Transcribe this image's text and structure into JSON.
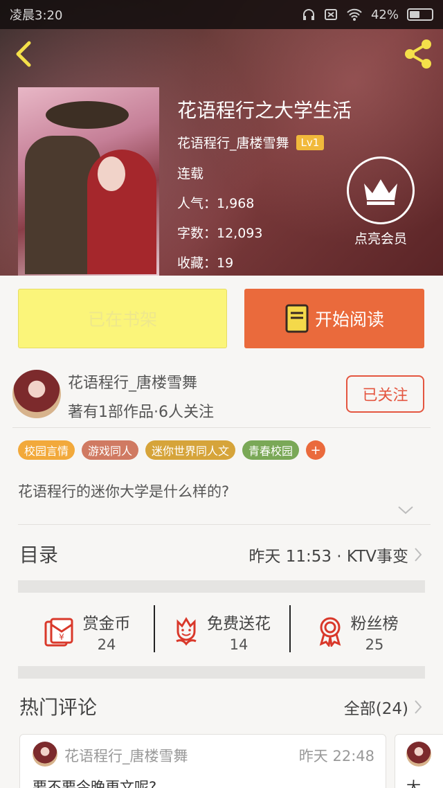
{
  "status_bar": {
    "time": "凌晨3:20",
    "battery": "42%"
  },
  "book": {
    "title": "花语程行之大学生活",
    "author": "花语程行_唐楼雪舞",
    "level": "Lv1",
    "state": "连载",
    "popularity": "人气：1,968",
    "words": "字数：12,093",
    "favorites": "收藏：19"
  },
  "vip": {
    "label": "点亮会员"
  },
  "actions": {
    "shelf_label": "已在书架",
    "read_label": "开始阅读"
  },
  "author_card": {
    "name": "花语程行_唐楼雪舞",
    "desc": "著有1部作品·6人关注",
    "follow_label": "已关注"
  },
  "tags": [
    {
      "label": "校园言情",
      "color": "#f2a93b"
    },
    {
      "label": "游戏同人",
      "color": "#d07a62"
    },
    {
      "label": "迷你世界同人文",
      "color": "#d6a43a"
    },
    {
      "label": "青春校园",
      "color": "#7aa857"
    }
  ],
  "summary": "花语程行的迷你大学是什么样的?",
  "catalog": {
    "label": "目录",
    "latest": "昨天 11:53 · KTV事变"
  },
  "stats": [
    {
      "label": "赏金币",
      "value": "24",
      "icon": "red-envelope-icon"
    },
    {
      "label": "免费送花",
      "value": "14",
      "icon": "flower-icon"
    },
    {
      "label": "粉丝榜",
      "value": "25",
      "icon": "ribbon-medal-icon"
    }
  ],
  "hot_comments": {
    "title": "热门评论",
    "all_label": "全部(24)",
    "items": [
      {
        "user": "花语程行_唐楼雪舞",
        "time": "昨天 22:48",
        "text": "要不要今晚更文呢?"
      }
    ],
    "next_preview_text": "大"
  },
  "colors": {
    "accent": "#ea6a3c",
    "shelf_yellow": "#fbf57a",
    "follow_red": "#e4553f",
    "badge_gold": "#f1b93b"
  }
}
